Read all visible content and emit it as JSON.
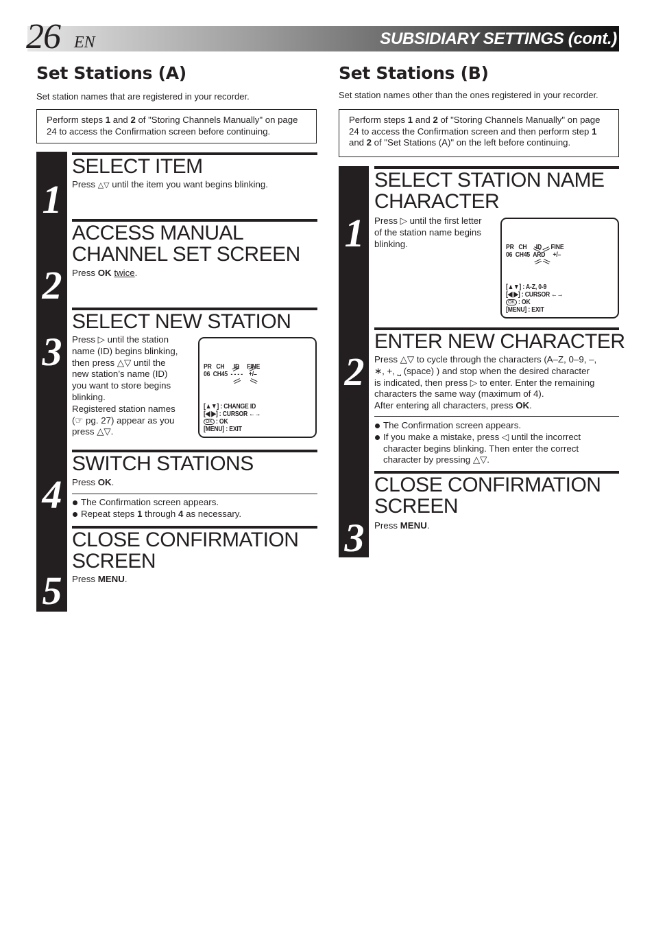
{
  "header": {
    "page_number": "26",
    "language": "EN",
    "title": "SUBSIDIARY SETTINGS (cont.)"
  },
  "section_a": {
    "title": "Set Stations (A)",
    "subtitle": "Set station names that are registered in your recorder.",
    "prereq": {
      "t1": "Perform steps ",
      "b1": "1",
      "t2": " and ",
      "b2": "2",
      "t3": " of \"Storing Channels Manually\" on page 24 to access the Confirmation screen before continuing."
    },
    "steps": [
      {
        "number": "1",
        "title": "SELECT ITEM",
        "body_pre": "Press ",
        "body_icon": "△▽",
        "body_post": " until the item you want begins blinking."
      },
      {
        "number": "2",
        "title_line1": "ACCESS MANUAL",
        "title_line2": "CHANNEL SET SCREEN",
        "body_pre": "Press ",
        "body_bold": "OK",
        "body_underline": "twice",
        "body_post": "."
      },
      {
        "number": "3",
        "title": "SELECT NEW STATION",
        "body_lines": [
          "Press ▷ until the station",
          "name (ID) begins blinking,",
          "then press △▽ until the",
          "new station’s name (ID)",
          "you want to store begins",
          "blinking.",
          "Registered station names",
          "(☞ pg. 27) appear as you",
          "press △▽."
        ],
        "osd": {
          "header_row": "PR   CH      ID     FINE",
          "value_row": "06  CH45  - - - -    +/–",
          "help_lines": [
            "[▲▼] : CHANGE ID",
            "[◀ ▶] : CURSOR ←→",
            ": OK",
            "[MENU] : EXIT"
          ],
          "ok_icon_label": "OK"
        }
      },
      {
        "number": "4",
        "title": "SWITCH STATIONS",
        "body_pre": "Press ",
        "body_bold": "OK",
        "body_post": ".",
        "bullets": [
          {
            "t1": "The Confirmation screen appears."
          },
          {
            "t1": "Repeat steps ",
            "b1": "1",
            "t2": " through ",
            "b2": "4",
            "t3": " as necessary."
          }
        ]
      },
      {
        "number": "5",
        "title_line1": "CLOSE CONFIRMATION",
        "title_line2": "SCREEN",
        "body_pre": "Press ",
        "body_bold": "MENU",
        "body_post": "."
      }
    ]
  },
  "section_b": {
    "title": "Set Stations (B)",
    "subtitle": "Set station names other than the ones registered in your recorder.",
    "prereq": {
      "t1": "Perform steps ",
      "b1": "1",
      "t2": " and ",
      "b2": "2",
      "t3": " of \"Storing Channels Manually\" on page 24 to access the Confirmation screen and then perform step ",
      "b3": "1",
      "t4": " and ",
      "b4": "2",
      "t5": " of \"Set Stations (A)\" on the left before continuing."
    },
    "steps": [
      {
        "number": "1",
        "title_line1": "SELECT STATION NAME",
        "title_line2": "CHARACTER",
        "body_lines": [
          "Press ▷ until the first letter",
          "of the station name begins",
          "blinking."
        ],
        "osd": {
          "header_row": "PR   CH      ID      FINE",
          "value_row": "06  CH45  ARD     +/–",
          "help_lines": [
            "[▲▼] : A-Z, 0-9",
            "[◀ ▶] : CURSOR ←→",
            ": OK",
            "[MENU] : EXIT"
          ],
          "ok_icon_label": "OK"
        }
      },
      {
        "number": "2",
        "title": "ENTER NEW CHARACTER",
        "body_lines": [
          "Press △▽ to cycle through the characters (A–Z, 0–9, –,",
          "∗, +, ⎵ (space) ) and stop when the desired character",
          "is indicated, then press ▷ to enter. Enter the remaining",
          "characters the same way (maximum of 4)."
        ],
        "body_last_pre": "After entering all characters, press ",
        "body_last_bold": "OK",
        "body_last_post": ".",
        "bullets": [
          "The Confirmation screen appears.",
          "If you make a mistake, press ◁ until the incorrect character begins blinking. Then enter the correct character by pressing △▽."
        ]
      },
      {
        "number": "3",
        "title_line1": "CLOSE CONFIRMATION",
        "title_line2": "SCREEN",
        "body_pre": "Press ",
        "body_bold": "MENU",
        "body_post": "."
      }
    ]
  }
}
